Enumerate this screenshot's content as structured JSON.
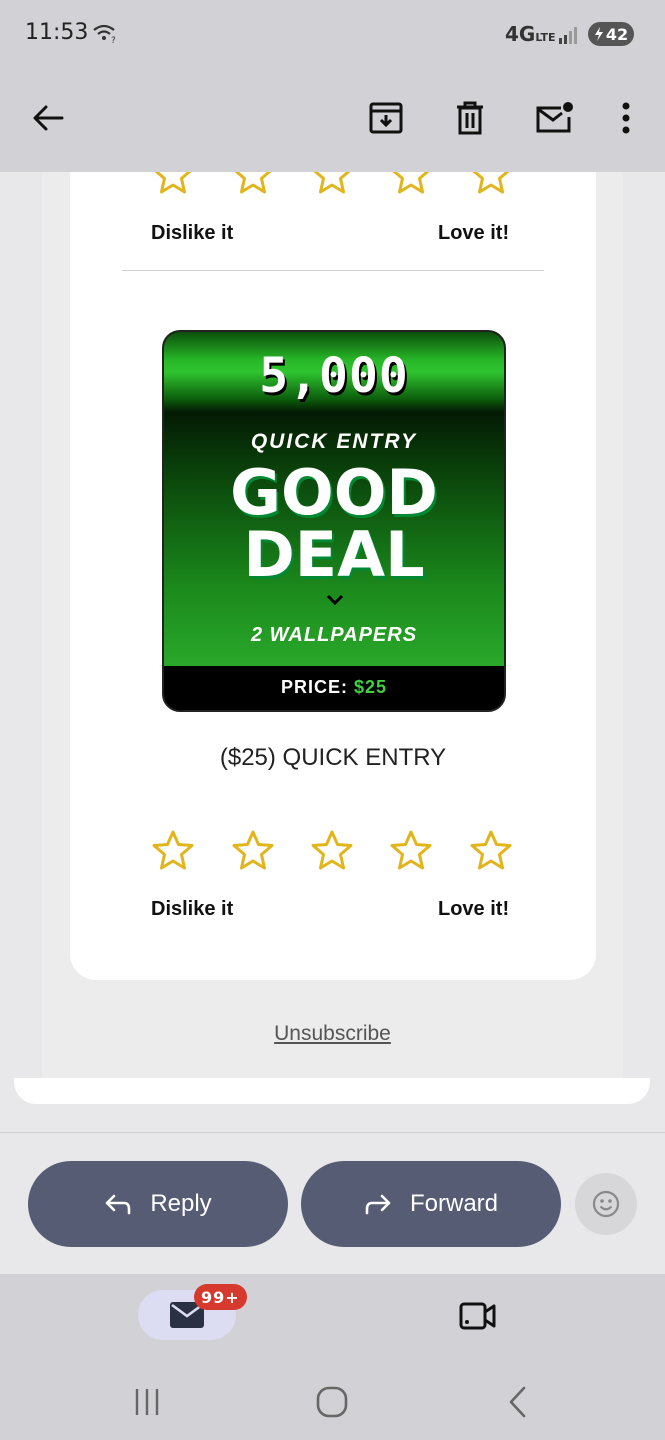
{
  "status_bar": {
    "time": "11:53",
    "network": "4G",
    "network_sub": "LTE",
    "battery": "42"
  },
  "toolbar": {
    "icons": [
      "back-arrow-icon",
      "archive-icon",
      "trash-icon",
      "mark-unread-icon",
      "more-options-icon"
    ]
  },
  "email": {
    "top_rating": {
      "low_label": "Dislike it",
      "high_label": "Love it!",
      "stars": 5
    },
    "promo": {
      "amount": "5,000",
      "subtitle": "QUICK ENTRY",
      "headline_1": "GOOD",
      "headline_2": "DEAL",
      "wallpapers": "2 WALLPAPERS",
      "price_label": "PRICE:",
      "price_value": "$25"
    },
    "product_title": "($25) QUICK ENTRY",
    "bottom_rating": {
      "low_label": "Dislike it",
      "high_label": "Love it!",
      "stars": 5
    },
    "unsubscribe": "Unsubscribe"
  },
  "actions": {
    "reply": "Reply",
    "forward": "Forward"
  },
  "bottom_nav": {
    "mail_badge": "99+"
  },
  "colors": {
    "star": "#e2b51d",
    "pill": "#555c73",
    "badge": "#d63a2f",
    "price_green": "#3fd13f"
  }
}
